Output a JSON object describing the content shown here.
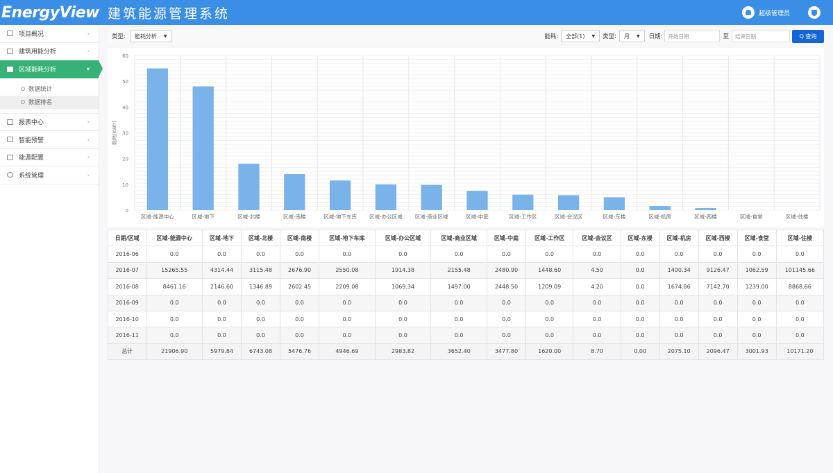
{
  "header": {
    "logo": "EnergyView",
    "system_title": "建筑能源管理系统",
    "user_name": "超级管理员"
  },
  "sidebar": {
    "items": [
      {
        "label": "项目概况"
      },
      {
        "label": "建筑用能分析"
      },
      {
        "label": "区域能耗分析",
        "active": true
      },
      {
        "label": "报表中心"
      },
      {
        "label": "智能预警"
      },
      {
        "label": "能源配置"
      },
      {
        "label": "系统管理"
      }
    ],
    "sub_items": [
      {
        "label": "数据统计"
      },
      {
        "label": "数据排名",
        "selected": true
      }
    ]
  },
  "toolbar": {
    "view_label": "类型:",
    "view_value": "能耗分析",
    "period_label": "能耗:",
    "period_value": "全部(1)",
    "type_label": "类型:",
    "type_value": "月",
    "date_label": "日期:",
    "start_placeholder": "开始日期",
    "to_label": "至",
    "end_placeholder": "结束日期",
    "search_label": "Q 查询"
  },
  "chart_data": {
    "type": "bar",
    "ylabel": "能耗(kWh)",
    "ytick_labels": [
      "0",
      "10",
      "20",
      "30",
      "40",
      "50",
      "60"
    ],
    "ylim": [
      0,
      60
    ],
    "color": "#7ab2ea",
    "categories": [
      "区域-能源中心",
      "区域-地下",
      "区域-北楼",
      "区域-南楼",
      "区域-地下车库",
      "区域-办公区域",
      "区域-商业区域",
      "区域-中庭",
      "区域-工作区",
      "区域-会议区",
      "区域-东楼",
      "区域-机房",
      "区域-西楼",
      "区域-食堂",
      "区域-住楼"
    ],
    "values": [
      55,
      48,
      18,
      14,
      11.5,
      10,
      9.8,
      7.5,
      6,
      5.8,
      5,
      1.6,
      0.8,
      0,
      0
    ]
  },
  "table": {
    "headers": [
      "日期/区域",
      "区域-能源中心",
      "区域-地下",
      "区域-北楼",
      "区域-南楼",
      "区域-地下车库",
      "区域-办公区域",
      "区域-商业区域",
      "区域-中庭",
      "区域-工作区",
      "区域-会议区",
      "区域-东楼",
      "区域-机房",
      "区域-西楼",
      "区域-食堂",
      "区域-住楼"
    ],
    "rows": [
      [
        "2016-06",
        "0.0",
        "0.0",
        "0.0",
        "0.0",
        "0.0",
        "0.0",
        "0.0",
        "0.0",
        "0.0",
        "0.0",
        "0.0",
        "0.0",
        "0.0",
        "0.0",
        "0.0"
      ],
      [
        "2016-07",
        "15265.55",
        "4314.44",
        "3115.48",
        "2676.90",
        "2550.08",
        "1914.38",
        "2155.48",
        "2480.90",
        "1448.60",
        "4.50",
        "0.0",
        "1400.34",
        "9126.47",
        "1062.59",
        "101145.66"
      ],
      [
        "2016-08",
        "8461.16",
        "2146.60",
        "1346.89",
        "2602.45",
        "2209.08",
        "1069.34",
        "1497.00",
        "2448.50",
        "1209.09",
        "4.20",
        "0.0",
        "1674.86",
        "7142.70",
        "1239.00",
        "8868.66"
      ],
      [
        "2016-09",
        "0.0",
        "0.0",
        "0.0",
        "0.0",
        "0.0",
        "0.0",
        "0.0",
        "0.0",
        "0.0",
        "0.0",
        "0.0",
        "0.0",
        "0.0",
        "0.0",
        "0.0"
      ],
      [
        "2016-10",
        "0.0",
        "0.0",
        "0.0",
        "0.0",
        "0.0",
        "0.0",
        "0.0",
        "0.0",
        "0.0",
        "0.0",
        "0.0",
        "0.0",
        "0.0",
        "0.0",
        "0.0"
      ],
      [
        "2016-11",
        "0.0",
        "0.0",
        "0.0",
        "0.0",
        "0.0",
        "0.0",
        "0.0",
        "0.0",
        "0.0",
        "0.0",
        "0.0",
        "0.0",
        "0.0",
        "0.0",
        "0.0"
      ]
    ],
    "total_row": [
      "总计",
      "21906.90",
      "5979.84",
      "6743.08",
      "5476.76",
      "4946.69",
      "2983.82",
      "3652.40",
      "3477.80",
      "1620.00",
      "8.70",
      "0.00",
      "2075.10",
      "2096.47",
      "3001.93",
      "10171.20"
    ]
  }
}
